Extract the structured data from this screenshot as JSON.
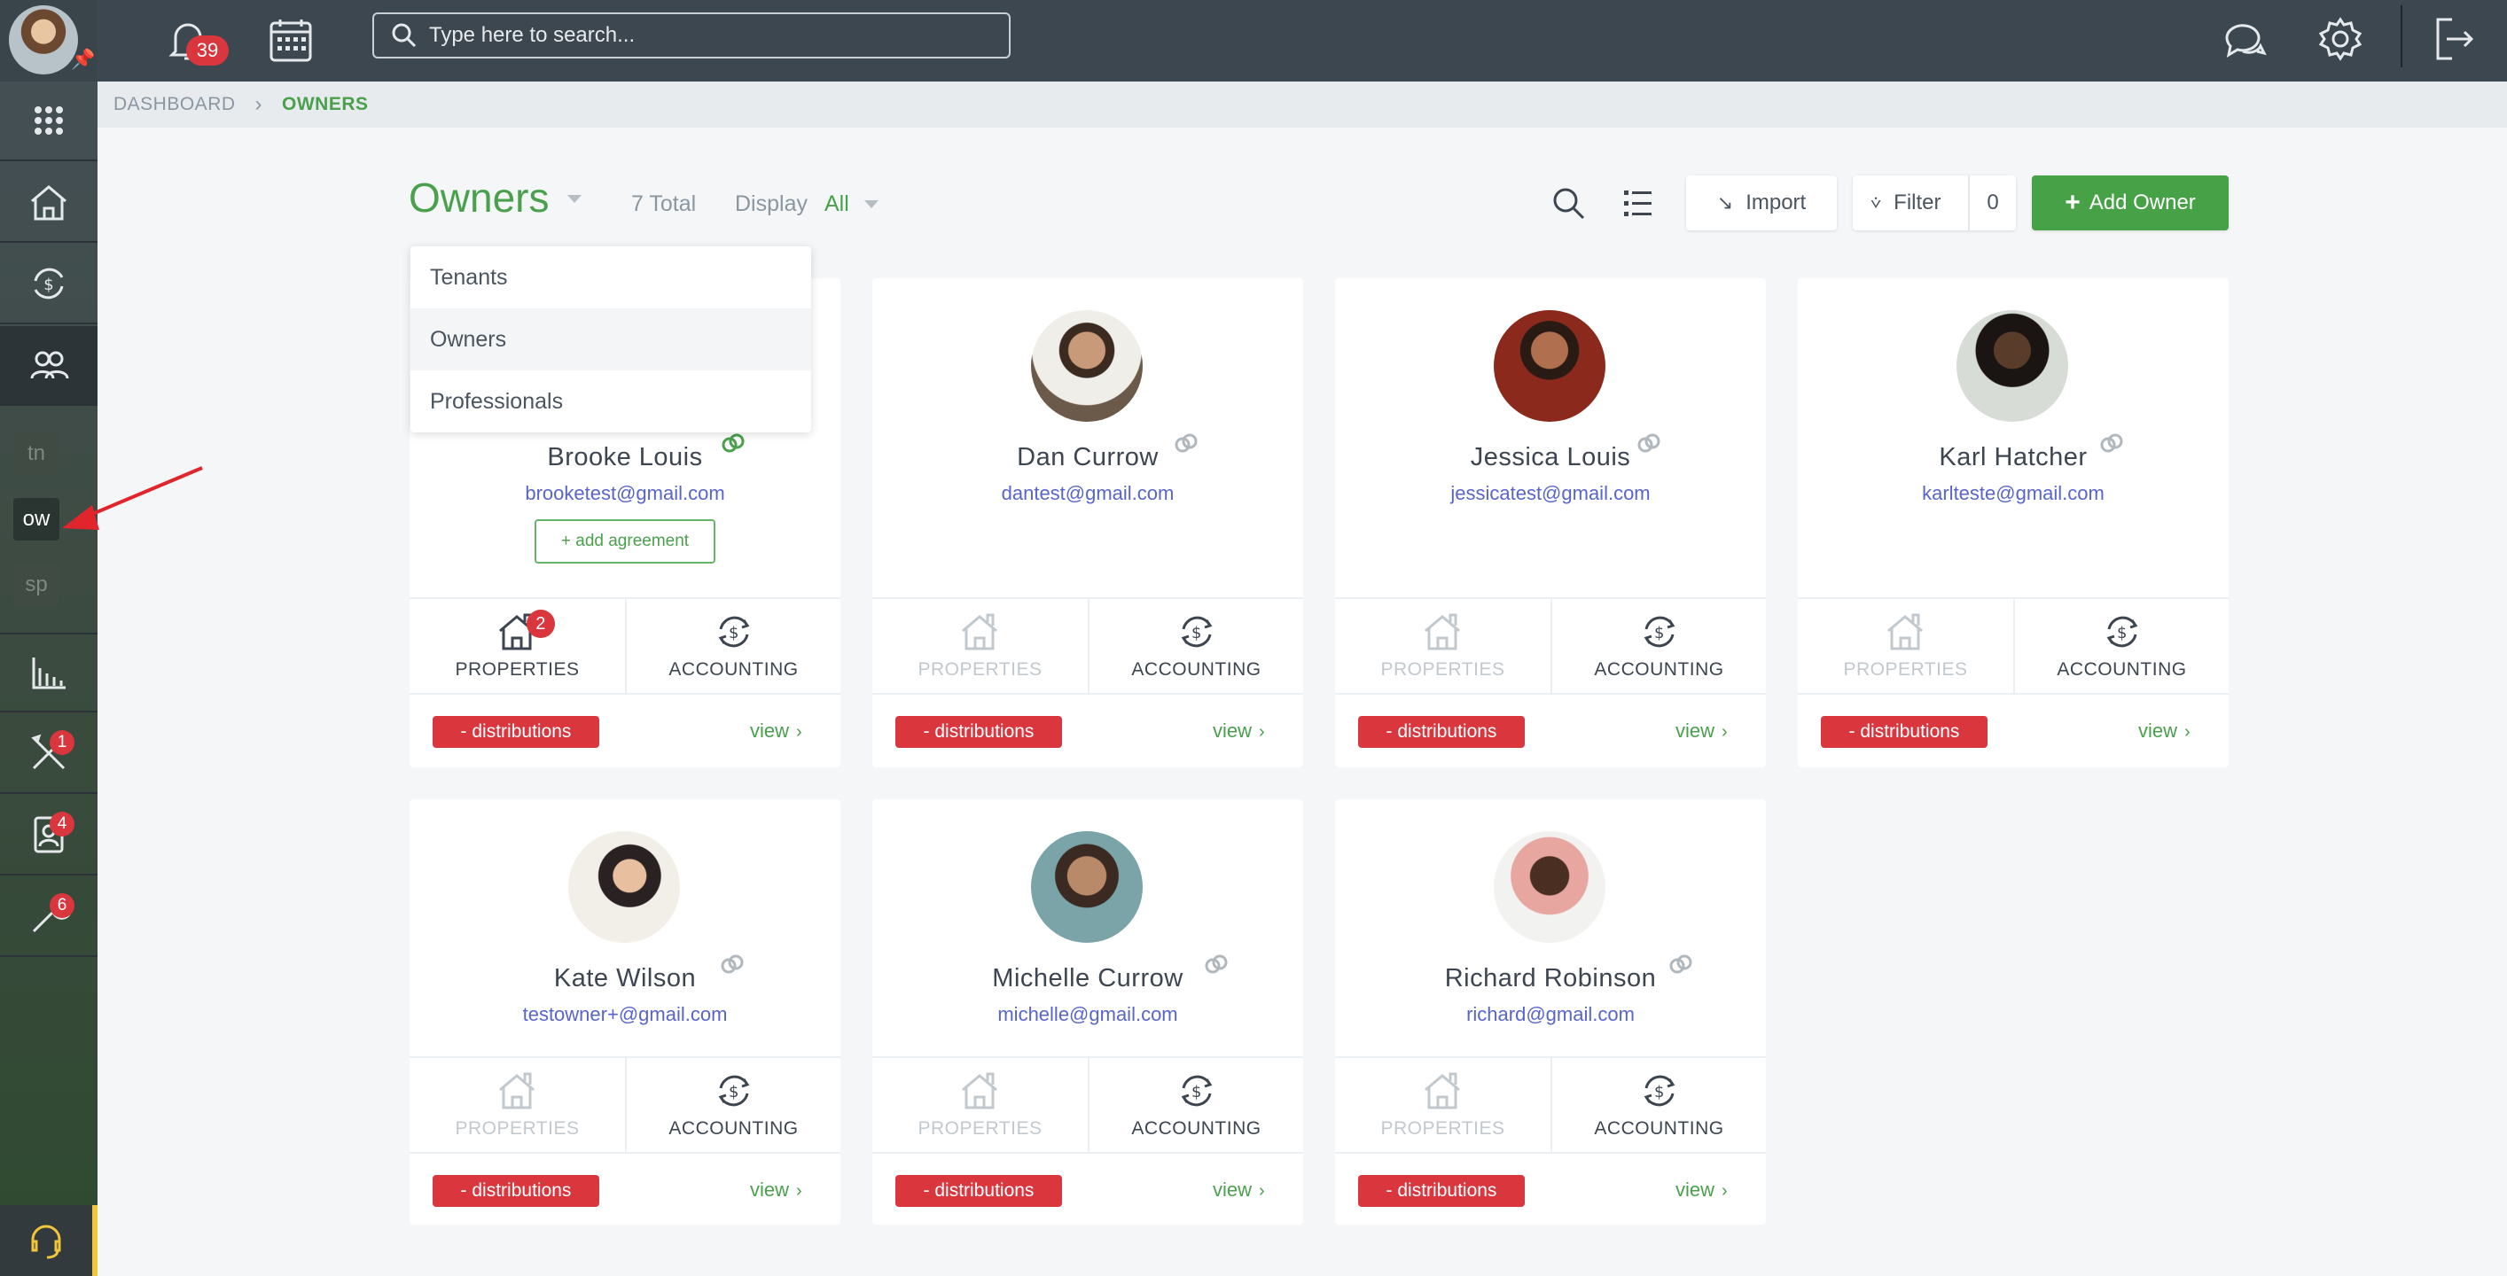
{
  "topbar": {
    "notification_count": "39",
    "search_placeholder": "Type here to search..."
  },
  "sidebar": {
    "abbreviations": [
      "tn",
      "ow",
      "sp"
    ],
    "badges": {
      "tools": "1",
      "contacts": "4",
      "leads": "6"
    }
  },
  "breadcrumb": {
    "root": "DASHBOARD",
    "current": "OWNERS"
  },
  "page": {
    "title": "Owners",
    "total": "7 Total",
    "display_label": "Display",
    "display_value": "All",
    "import_label": "Import",
    "filter_label": "Filter",
    "filter_count": "0",
    "add_label": "Add Owner"
  },
  "dropdown": {
    "items": [
      "Tenants",
      "Owners",
      "Professionals"
    ]
  },
  "card_labels": {
    "properties": "PROPERTIES",
    "accounting": "ACCOUNTING",
    "distributions": "- distributions",
    "view": "view",
    "add_agreement": "+ add agreement"
  },
  "owners": [
    {
      "name": "Brooke Louis",
      "email": "brooketest@gmail.com",
      "properties_count": "2"
    },
    {
      "name": "Dan Currow",
      "email": "dantest@gmail.com"
    },
    {
      "name": "Jessica Louis",
      "email": "jessicatest@gmail.com"
    },
    {
      "name": "Karl Hatcher",
      "email": "karlteste@gmail.com"
    },
    {
      "name": "Kate Wilson",
      "email": "testowner+@gmail.com"
    },
    {
      "name": "Michelle Currow",
      "email": "michelle@gmail.com"
    },
    {
      "name": "Richard Robinson",
      "email": "richard@gmail.com"
    }
  ],
  "colors": {
    "accent": "#4aa04c",
    "danger": "#d9363e",
    "link": "#5865c9"
  }
}
